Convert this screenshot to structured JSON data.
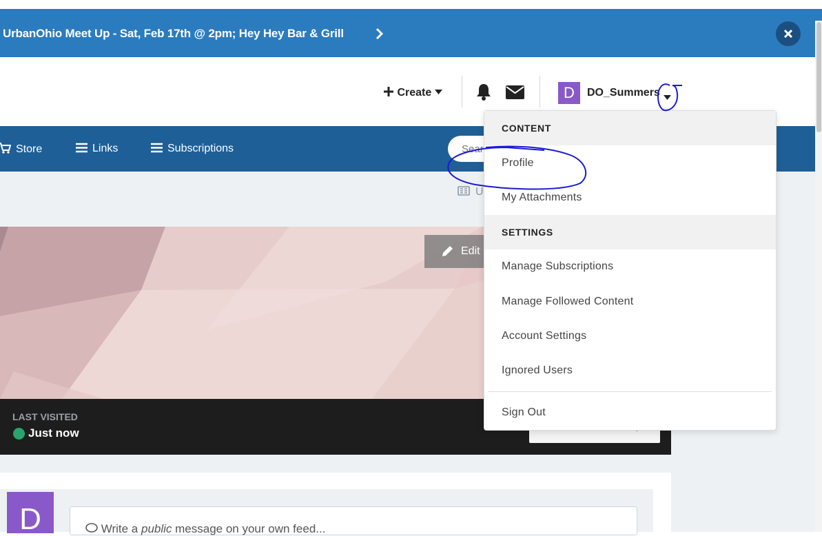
{
  "announcement": {
    "text": "UrbanOhio Meet Up - Sat, Feb 17th @ 2pm; Hey Hey Bar & Grill"
  },
  "header": {
    "create_label": "Create",
    "user": {
      "initial": "D",
      "name": "DO_Summers",
      "avatar_color": "#8a59c9"
    }
  },
  "nav": {
    "items": [
      {
        "label": "Store",
        "icon": "cart-icon"
      },
      {
        "label": "Links",
        "icon": "list-icon"
      },
      {
        "label": "Subscriptions",
        "icon": "list-icon"
      }
    ],
    "search_placeholder": "Search...",
    "search_visible": "Sear"
  },
  "profile": {
    "sub_nav_visible": "U",
    "edit_label": "Edit",
    "last_visited_label": "LAST VISITED",
    "last_visited_value": "Just now",
    "follow_visible": "y"
  },
  "feed": {
    "avatar_initial": "D",
    "composer_pre": "Write a ",
    "composer_em": "public",
    "composer_post": " message on your own feed..."
  },
  "menu": {
    "content_heading": "CONTENT",
    "content_items": [
      "Profile",
      "My Attachments"
    ],
    "settings_heading": "SETTINGS",
    "settings_items": [
      "Manage Subscriptions",
      "Manage Followed Content",
      "Account Settings",
      "Ignored Users"
    ],
    "sign_out": "Sign Out"
  },
  "colors": {
    "announce_bg": "#2b7bbf",
    "nav_bg": "#1e5f97",
    "online_dot": "#28a56b",
    "annotation": "#1a1ad6"
  }
}
